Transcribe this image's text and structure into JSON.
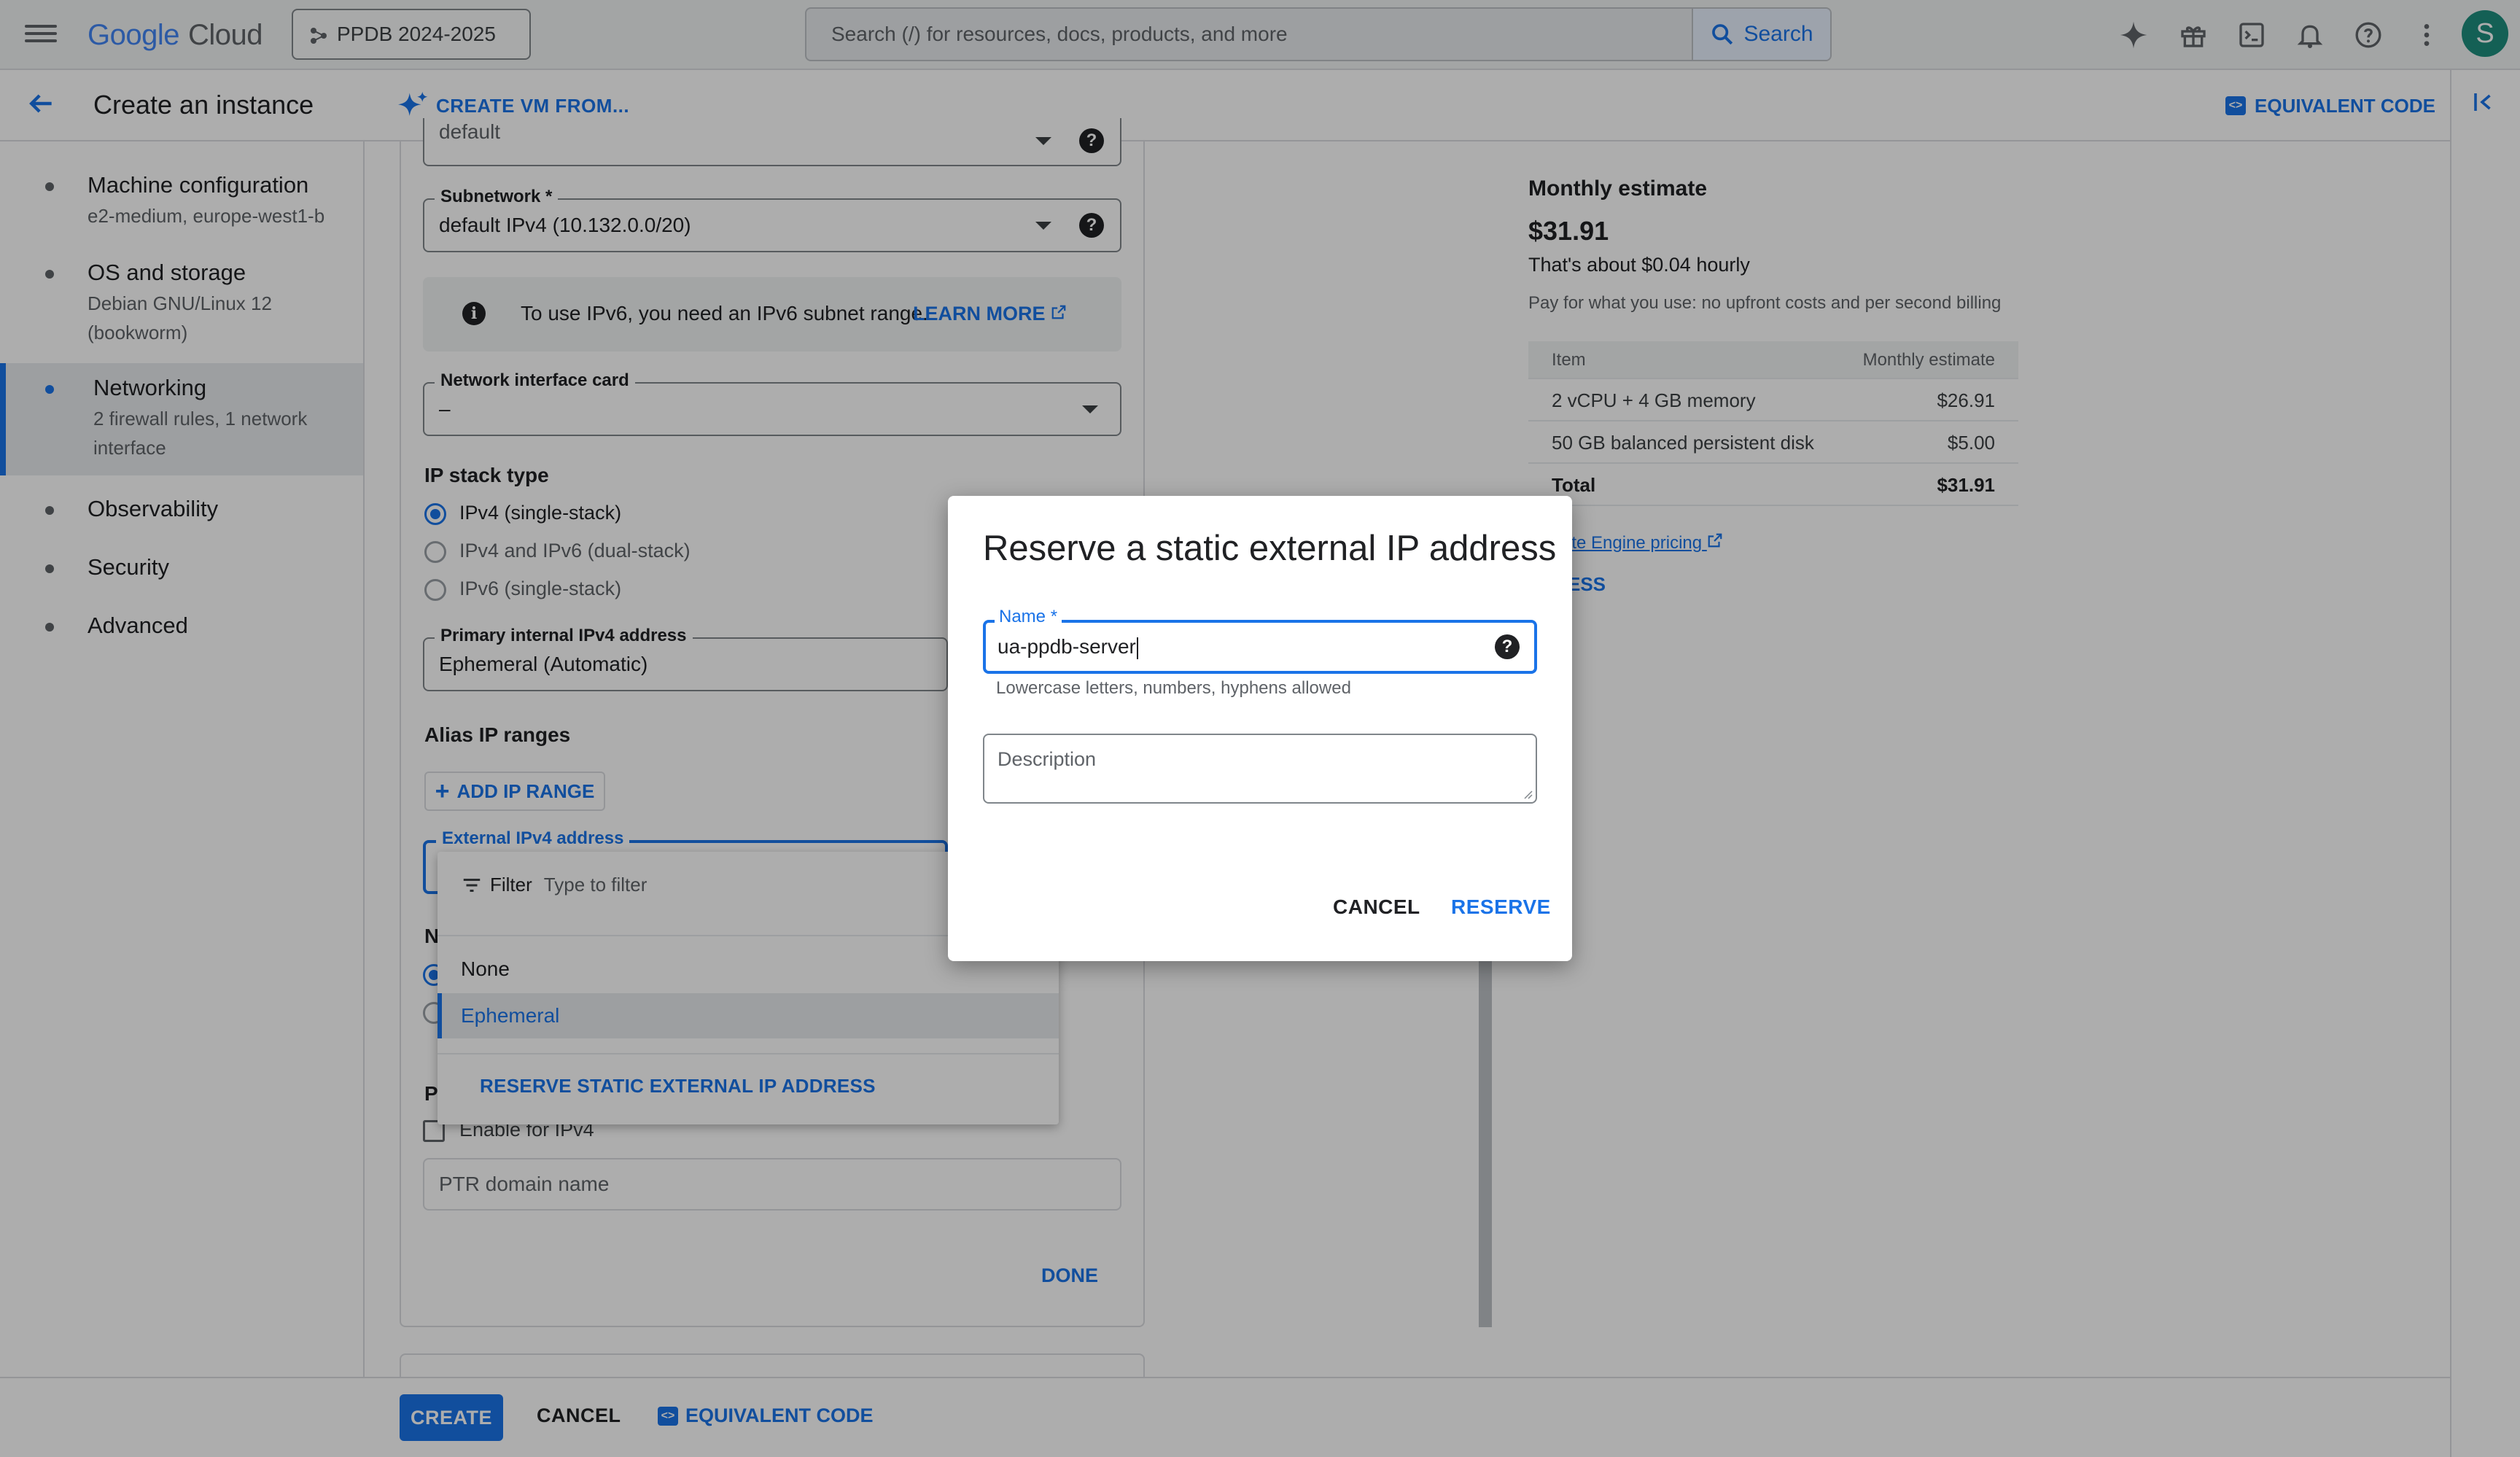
{
  "app": {
    "logo_google": "Google",
    "logo_cloud": "Cloud",
    "project": "PPDB 2024-2025"
  },
  "search": {
    "placeholder": "Search (/) for resources, docs, products, and more",
    "button": "Search"
  },
  "user": {
    "avatar_letter": "S"
  },
  "header": {
    "title": "Create an instance",
    "create_from": "CREATE VM FROM...",
    "equivalent_code": "EQUIVALENT CODE"
  },
  "nav": [
    {
      "title": "Machine configuration",
      "sub": "e2-medium, europe-west1-b"
    },
    {
      "title": "OS and storage",
      "sub": "Debian GNU/Linux 12 (bookworm)"
    },
    {
      "title": "Networking",
      "sub": "2 firewall rules, 1 network interface"
    },
    {
      "title": "Observability",
      "sub": ""
    },
    {
      "title": "Security",
      "sub": ""
    },
    {
      "title": "Advanced",
      "sub": ""
    }
  ],
  "form": {
    "network_value": "default",
    "subnetwork_label": "Subnetwork *",
    "subnetwork_value": "default IPv4 (10.132.0.0/20)",
    "ipv6_info": "To use IPv6, you need an IPv6 subnet range.",
    "learn_more": "LEARN MORE",
    "nic_label": "Network interface card",
    "nic_value": "–",
    "ip_stack_label": "IP stack type",
    "ip_stack_options": [
      "IPv4 (single-stack)",
      "IPv4 and IPv6 (dual-stack)",
      "IPv6 (single-stack)"
    ],
    "primary_ip_label": "Primary internal IPv4 address",
    "primary_ip_value": "Ephemeral (Automatic)",
    "alias_label": "Alias IP ranges",
    "add_ip_range": "ADD IP RANGE",
    "external_label": "External IPv4 address",
    "peek_n": "N",
    "peek_p": "P",
    "enable_ipv4": "Enable for IPv4",
    "ptr_placeholder": "PTR domain name",
    "done": "DONE"
  },
  "dropdown": {
    "filter_label": "Filter",
    "filter_placeholder": "Type to filter",
    "options": [
      "None",
      "Ephemeral"
    ],
    "reserve_link": "RESERVE STATIC EXTERNAL IP ADDRESS"
  },
  "estimate": {
    "title": "Monthly estimate",
    "price": "$31.91",
    "hourly": "That's about $0.04 hourly",
    "note": "Pay for what you use: no upfront costs and per second billing",
    "col_item": "Item",
    "col_est": "Monthly estimate",
    "rows": [
      {
        "item": "2 vCPU + 4 GB memory",
        "cost": "$26.91"
      },
      {
        "item": "50 GB balanced persistent disk",
        "cost": "$5.00"
      }
    ],
    "total_label": "Total",
    "total_value": "$31.91",
    "pricing_link": "ute Engine pricing",
    "less_link": "ESS"
  },
  "dialog": {
    "title": "Reserve a static external IP address",
    "name_label": "Name *",
    "name_value": "ua-ppdb-server",
    "hint": "Lowercase letters, numbers, hyphens allowed",
    "description_placeholder": "Description",
    "cancel": "CANCEL",
    "reserve": "RESERVE"
  },
  "bottom": {
    "create": "CREATE",
    "cancel": "CANCEL",
    "equivalent_code": "EQUIVALENT CODE"
  }
}
